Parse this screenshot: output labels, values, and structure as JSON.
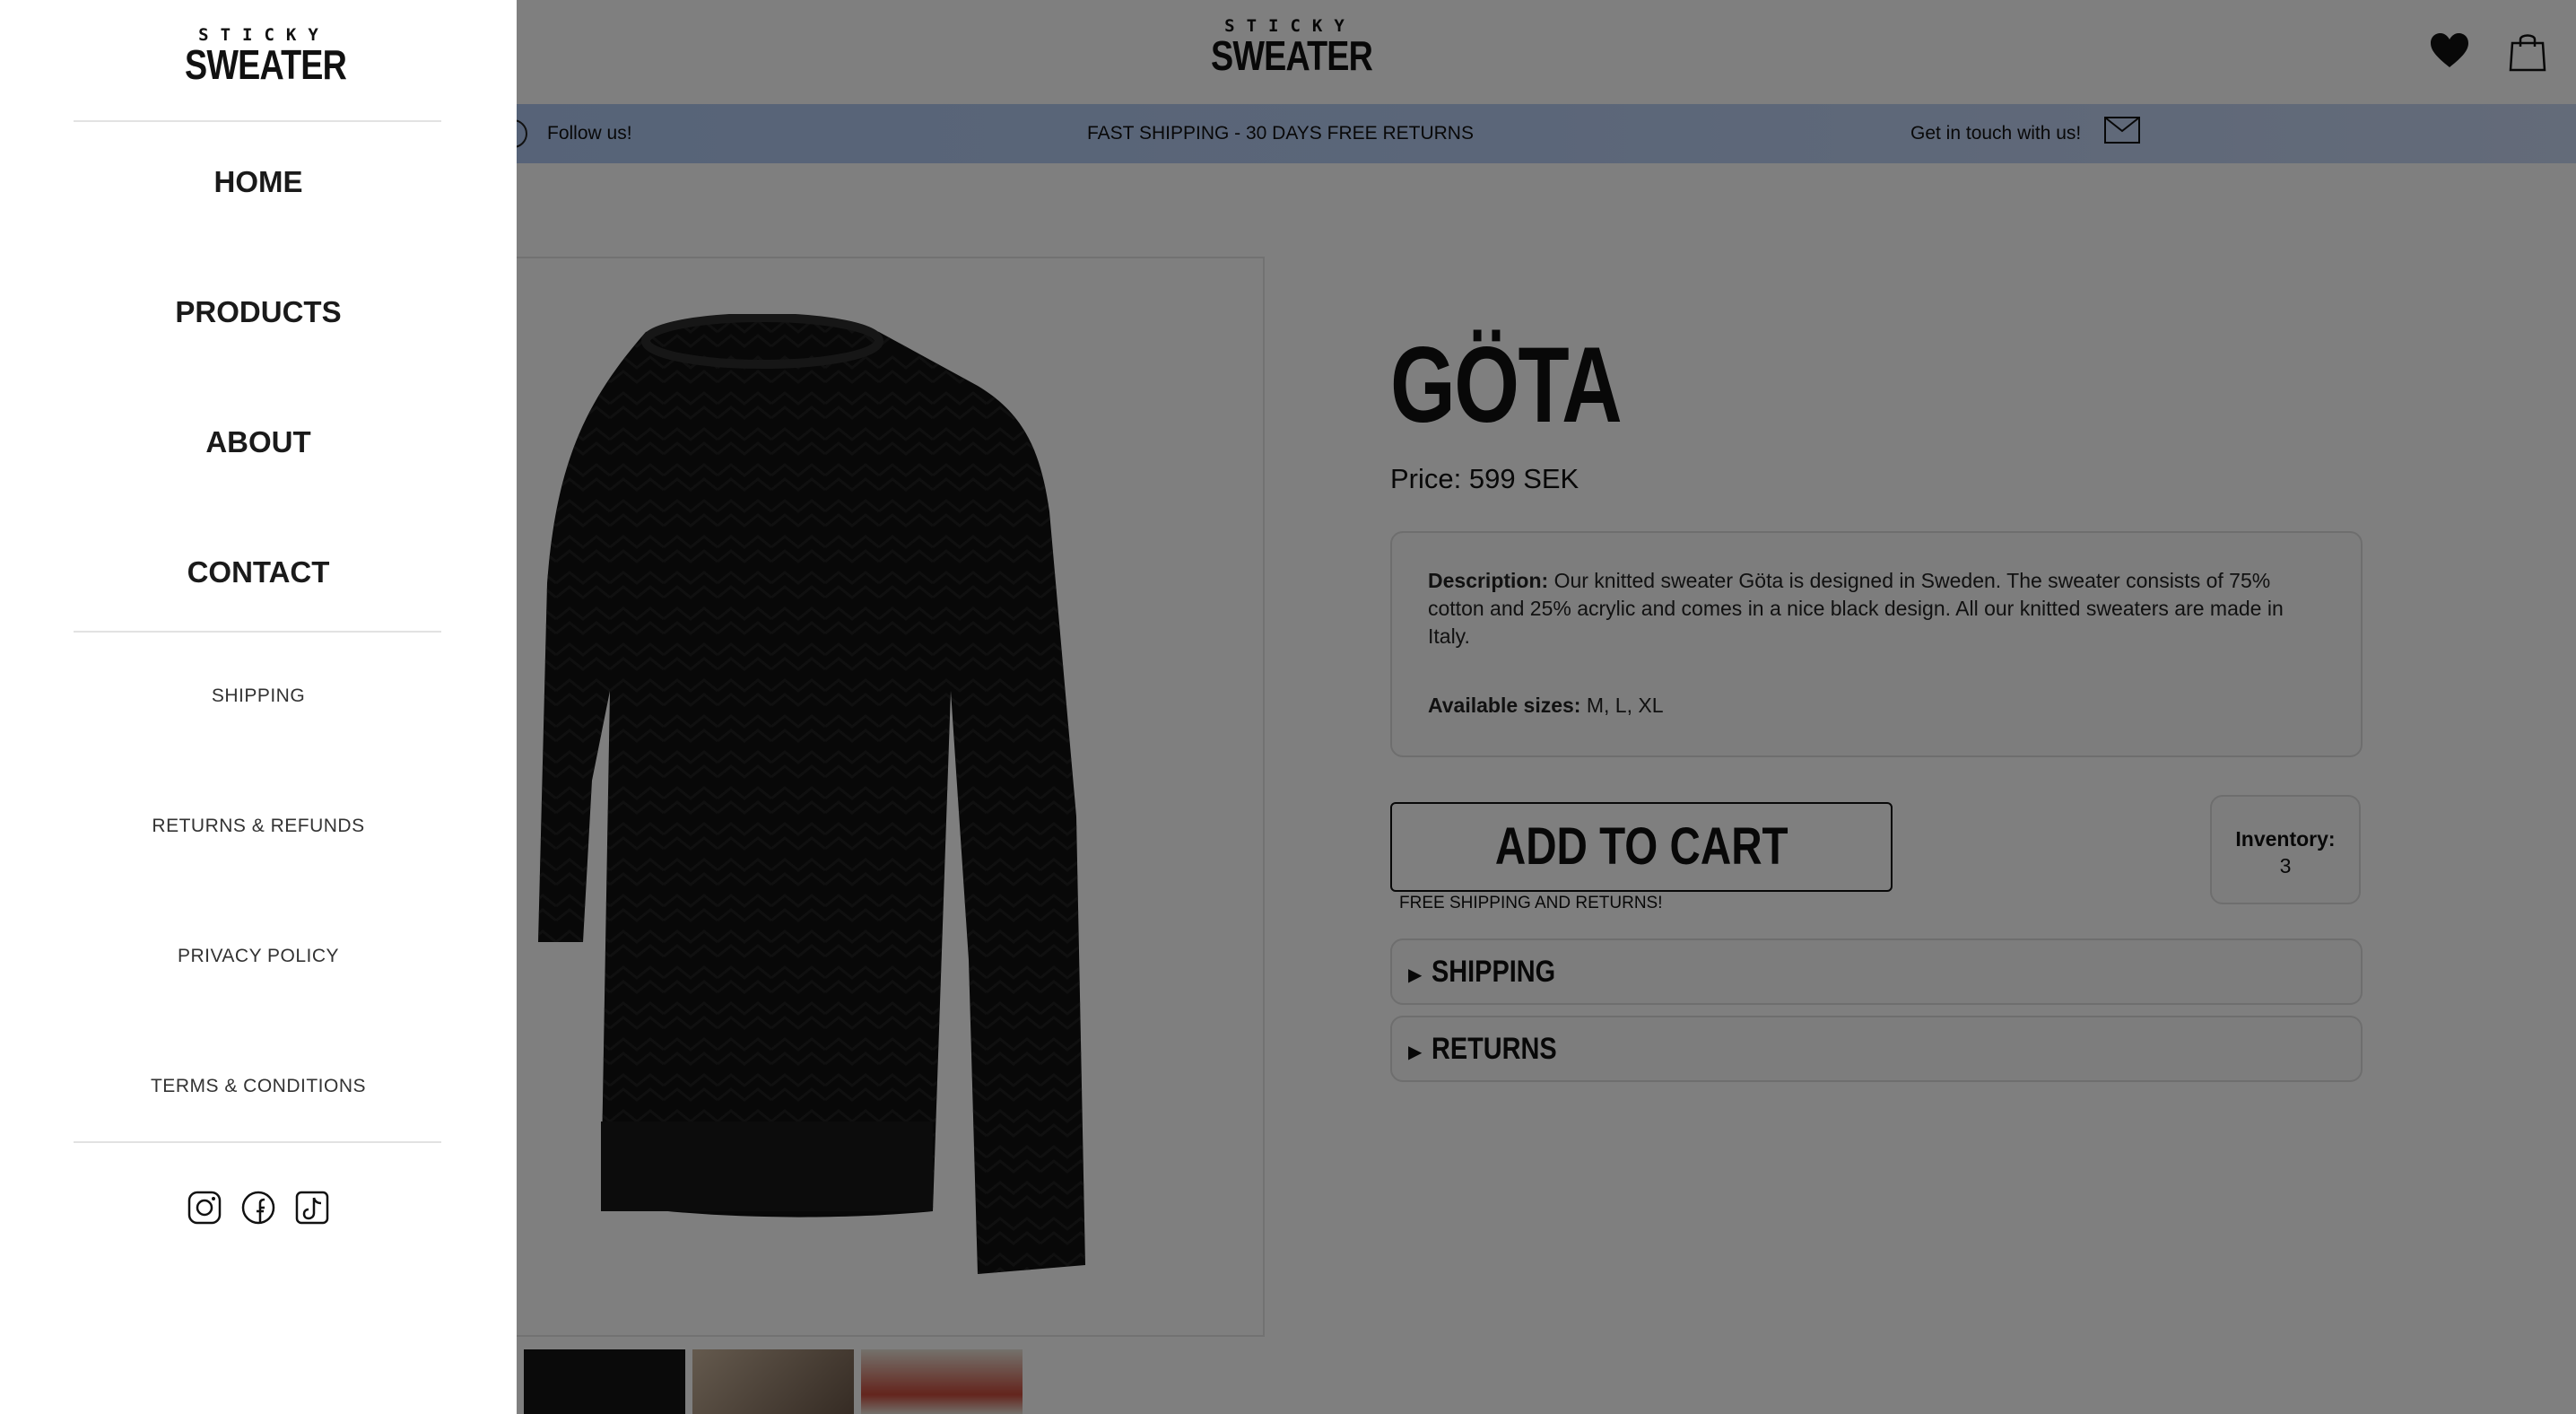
{
  "brand": {
    "line1": "STICKY",
    "line2": "SWEATER"
  },
  "drawer": {
    "main_nav": [
      "HOME",
      "PRODUCTS",
      "ABOUT",
      "CONTACT"
    ],
    "secondary_nav": [
      "SHIPPING",
      "RETURNS & REFUNDS",
      "PRIVACY POLICY",
      "TERMS & CONDITIONS"
    ],
    "social": [
      "instagram-icon",
      "facebook-icon",
      "tiktok-icon"
    ]
  },
  "promo": {
    "follow": "Follow us!",
    "shipping": "FAST SHIPPING - 30 DAYS FREE RETURNS",
    "contact": "Get in touch with us!"
  },
  "product": {
    "name": "GÖTA",
    "price": "Price: 599 SEK",
    "description_label": "Description:",
    "description": "Our knitted sweater Göta is designed in Sweden. The sweater consists of 75% cotton and 25% acrylic and comes in a nice black design. All our knitted sweaters are made in Italy.",
    "sizes_label": "Available sizes:",
    "sizes": "M, L, XL",
    "add_to_cart": "ADD TO CART",
    "free_note": "FREE SHIPPING AND RETURNS!",
    "inventory_label": "Inventory:",
    "inventory_value": "3",
    "accordions": [
      "SHIPPING",
      "RETURNS"
    ],
    "arrow": "▶"
  },
  "colors": {
    "promo_bar": "#b7cdf2",
    "overlay": "rgba(0,0,0,0.5)"
  }
}
